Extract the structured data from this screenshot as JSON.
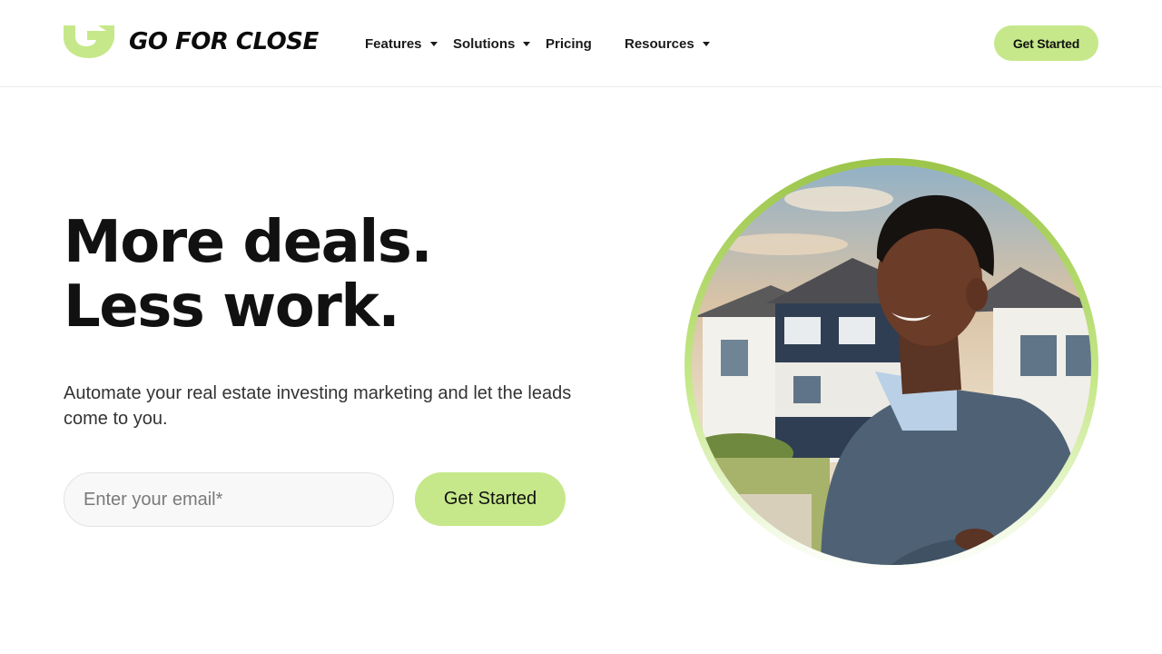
{
  "brand": {
    "name": "GO FOR CLOSE",
    "accent_color": "#c6e88a",
    "logo_icon": "g-arrow-logo-icon"
  },
  "nav": {
    "items": [
      {
        "label": "Features",
        "has_dropdown": true
      },
      {
        "label": "Solutions",
        "has_dropdown": true
      },
      {
        "label": "Pricing",
        "has_dropdown": false
      },
      {
        "label": "Resources",
        "has_dropdown": true
      }
    ],
    "cta_label": "Get Started"
  },
  "hero": {
    "headline_line1": "More deals.",
    "headline_line2": "Less work.",
    "subtext": "Automate your real estate investing marketing and let the leads come to you.",
    "email_placeholder": "Enter your email*",
    "cta_label": "Get Started",
    "image_icon": "smiling-man-portrait-icon"
  }
}
